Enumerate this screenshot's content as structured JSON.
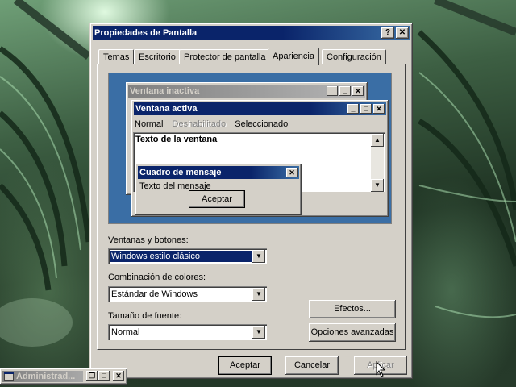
{
  "window": {
    "title": "Propiedades de Pantalla",
    "help_btn": "?",
    "close_btn": "✕"
  },
  "tabs": [
    {
      "label": "Temas",
      "active": false
    },
    {
      "label": "Escritorio",
      "active": false
    },
    {
      "label": "Protector de pantalla",
      "active": false
    },
    {
      "label": "Apariencia",
      "active": true
    },
    {
      "label": "Configuración",
      "active": false
    }
  ],
  "preview": {
    "inactive_title": "Ventana inactiva",
    "active_title": "Ventana activa",
    "menu": {
      "normal": "Normal",
      "disabled": "Deshabilitado",
      "selected": "Seleccionado"
    },
    "window_text": "Texto de la ventana",
    "msgbox_title": "Cuadro de mensaje",
    "msgbox_text": "Texto del mensaje",
    "msgbox_ok": "Aceptar"
  },
  "fields": {
    "windows_buttons_label": "Ventanas y botones:",
    "windows_buttons_value": "Windows estilo clásico",
    "color_scheme_label": "Combinación de colores:",
    "color_scheme_value": "Estándar de Windows",
    "font_size_label": "Tamaño de fuente:",
    "font_size_value": "Normal"
  },
  "side_buttons": {
    "effects": "Efectos...",
    "advanced": "Opciones avanzadas"
  },
  "footer": {
    "ok": "Aceptar",
    "cancel": "Cancelar",
    "apply": "Aplicar"
  },
  "taskbar_window": {
    "title": "Administrad..."
  },
  "colors": {
    "active_title": "#0a246a",
    "inactive_title": "#808080",
    "desktop_preview": "#3a6ea5",
    "face": "#d4d0c8"
  }
}
